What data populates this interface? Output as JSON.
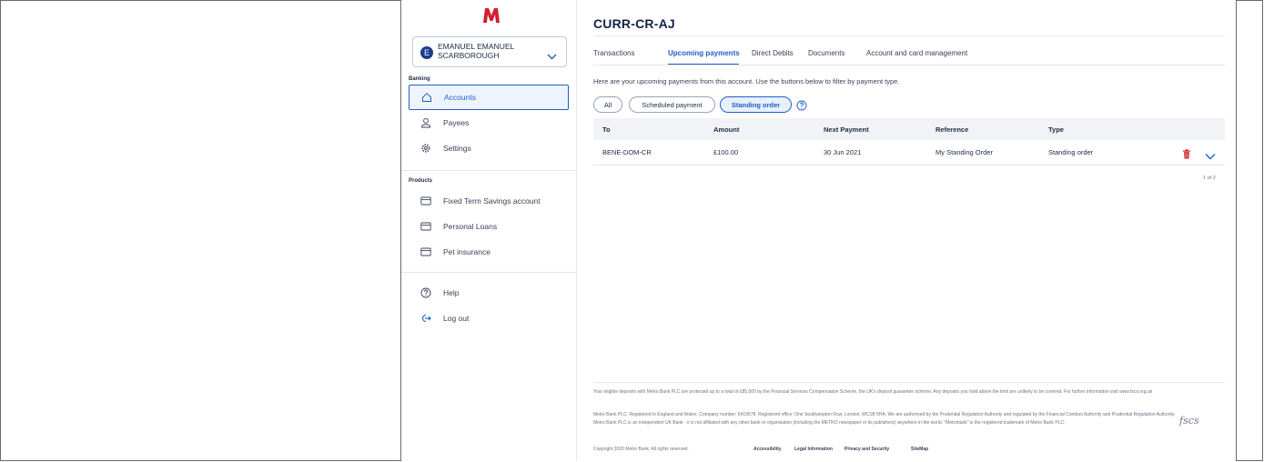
{
  "brand": {
    "logo_letter": "M",
    "accent": "#1d5fc8",
    "logo_color": "#d0202e"
  },
  "account_selector": {
    "avatar_letter": "E",
    "name_line1": "EMANUEL EMANUEL",
    "name_line2": "SCARBOROUGH"
  },
  "sidebar": {
    "banking_label": "Banking",
    "banking_items": [
      {
        "label": "Accounts",
        "icon": "home-icon",
        "active": true
      },
      {
        "label": "Payees",
        "icon": "person-icon",
        "active": false
      },
      {
        "label": "Settings",
        "icon": "gear-icon",
        "active": false
      }
    ],
    "products_label": "Products",
    "product_items": [
      {
        "label": "Fixed Term Savings account",
        "icon": "card-icon"
      },
      {
        "label": "Personal Loans",
        "icon": "card-icon"
      },
      {
        "label": "Pet insurance",
        "icon": "card-icon"
      }
    ],
    "help_label": "Help",
    "logout_label": "Log out"
  },
  "main": {
    "title": "CURR-CR-AJ",
    "tabs": [
      {
        "label": "Transactions",
        "active": false
      },
      {
        "label": "Upcoming payments",
        "active": true
      },
      {
        "label": "Direct Debits",
        "active": false
      },
      {
        "label": "Documents",
        "active": false
      },
      {
        "label": "Account and card management",
        "active": false
      }
    ],
    "intro": "Here are your upcoming payments from this account. Use the buttons below to filter by payment type.",
    "filters": [
      {
        "label": "All",
        "active": false
      },
      {
        "label": "Scheduled payment",
        "active": false
      },
      {
        "label": "Standing order",
        "active": true
      }
    ],
    "table": {
      "columns": [
        "To",
        "Amount",
        "Next Payment",
        "Reference",
        "Type"
      ],
      "rows": [
        {
          "to": "BENE-DOM-CR",
          "amount": "£100.00",
          "next_payment": "30 Jun 2021",
          "reference": "My Standing Order",
          "type": "Standing order"
        }
      ]
    },
    "pager": "1 of 2"
  },
  "footer": {
    "fscs_text": "Your eligible deposits with Metro Bank PLC are protected up to a total of £85,000 by the Financial Services Compensation Scheme, the UK's deposit guarantee scheme. Any deposits you hold above the limit are unlikely to be covered. For further information visit www.fscs.org.uk",
    "legal_text": "Metro Bank PLC. Registered in England and Wales. Company number: 6419578. Registered office: One Southampton Row, London, WC1B 5HA. We are authorised by the Prudential Regulation Authority and regulated by the Financial Conduct Authority and Prudential Regulation Authority. Metro Bank PLC is an independent UK Bank - it is not affiliated with any other bank or organisation (including the METRO newspaper or its publishers) anywhere in the world. \"Metrobank\" is the registered trademark of Metro Bank PLC.",
    "fscs_logo": "fscs",
    "copyright": "Copyright 2020 Metro Bank. All rights reserved.",
    "links": [
      "Accessibility",
      "Legal Information",
      "Privacy and Security",
      "SiteMap"
    ]
  }
}
